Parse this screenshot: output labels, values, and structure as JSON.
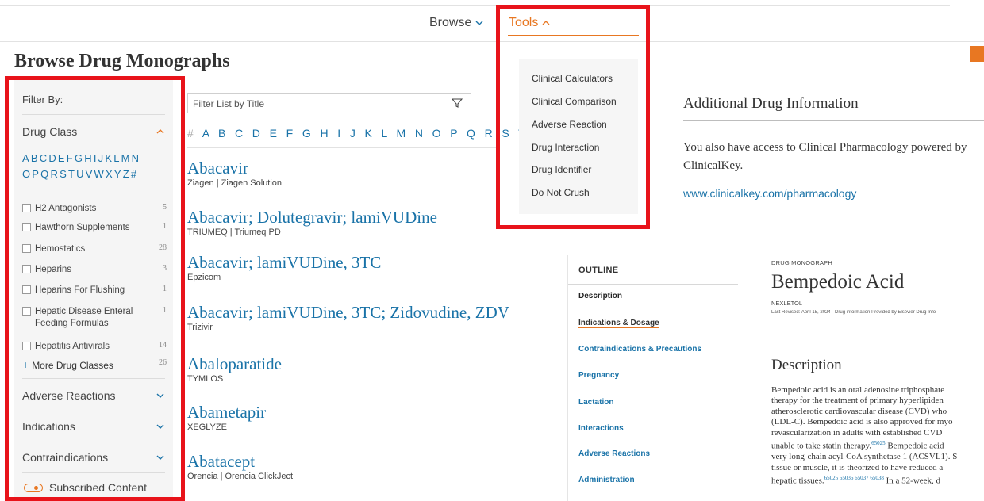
{
  "nav": {
    "browse_label": "Browse",
    "tools_label": "Tools"
  },
  "page_title": "Browse Drug Monographs",
  "sidebar": {
    "filter_by": "Filter By:",
    "drug_class_label": "Drug Class",
    "letters_line1": "ABCDEFGHIJKLMN",
    "letters_line2": "OPQRSTUVWXYZ#",
    "items": [
      {
        "label": "H2 Antagonists",
        "count": "5"
      },
      {
        "label": "Hawthorn Supplements",
        "count": "1"
      },
      {
        "label": "Hemostatics",
        "count": "28"
      },
      {
        "label": "Heparins",
        "count": "3"
      },
      {
        "label": "Heparins For Flushing",
        "count": "1"
      },
      {
        "label": "Hepatic Disease Enteral Feeding Formulas",
        "count": "1"
      },
      {
        "label": "Hepatitis Antivirals",
        "count": "14"
      }
    ],
    "more_label": "More Drug Classes",
    "more_count": "26",
    "sections": [
      "Adverse Reactions",
      "Indications",
      "Contraindications"
    ],
    "subscribed_label": "Subscribed Content"
  },
  "list": {
    "filter_placeholder": "Filter List by Title",
    "alphabet_hash": "#",
    "alphabet": "A B C D E F G H I J K L M N O P Q R S T U",
    "alphabet_faded": "V",
    "drugs": [
      {
        "name": "Abacavir",
        "brands": "Ziagen | Ziagen Solution"
      },
      {
        "name": "Abacavir; Dolutegravir; lamiVUDine",
        "brands": "TRIUMEQ | Triumeq PD"
      },
      {
        "name": "Abacavir; lamiVUDine, 3TC",
        "brands": "Epzicom"
      },
      {
        "name": "Abacavir; lamiVUDine, 3TC; Zidovudine, ZDV",
        "brands": "Trizivir"
      },
      {
        "name": "Abaloparatide",
        "brands": "TYMLOS"
      },
      {
        "name": "Abametapir",
        "brands": "XEGLYZE"
      },
      {
        "name": "Abatacept",
        "brands": "Orencia | Orencia ClickJect"
      }
    ]
  },
  "tools_menu": {
    "items": [
      "Clinical Calculators",
      "Clinical Comparison",
      "Adverse Reaction",
      "Drug Interaction",
      "Drug Identifier",
      "Do Not Crush"
    ]
  },
  "additional": {
    "title": "Additional Drug Information",
    "text": "You also have access to Clinical Pharmacology powered by ClinicalKey.",
    "link": "www.clinicalkey.com/pharmacology"
  },
  "outline": {
    "heading": "OUTLINE",
    "items": [
      "Description",
      "Indications & Dosage",
      "Contraindications & Precautions",
      "Pregnancy",
      "Lactation",
      "Interactions",
      "Adverse Reactions",
      "Administration"
    ]
  },
  "monograph": {
    "kicker": "DRUG MONOGRAPH",
    "title": "Bempedoic Acid",
    "brand": "NEXLETOL",
    "revised": "Last Revised: April 15, 2024 - Drug information Provided by Elsevier Drug Info",
    "description_title": "Description",
    "desc_lines": [
      "Bempedoic acid is an oral adenosine triphosphate",
      "therapy for the treatment of primary hyperlipiden",
      "atherosclerotic cardiovascular disease (CVD) who",
      "(LDL-C). Bempedoic acid is also approved for myo",
      "revascularization in adults with established CVD",
      "unable to take statin therapy.",
      "very long-chain acyl-CoA synthetase 1 (ACSVL1). S",
      "tissue or muscle, it is theorized to have reduced a",
      "hepatic tissues."
    ],
    "desc_line6_tail": " Bempedoic acid",
    "desc_line9_tail": " In a 52-week, d",
    "ref_6": "65025",
    "ref_9": "65025 65036 65037 65038"
  },
  "colors": {
    "accent": "#e87722",
    "link": "#1a73a8",
    "annotation": "#e8131a"
  }
}
